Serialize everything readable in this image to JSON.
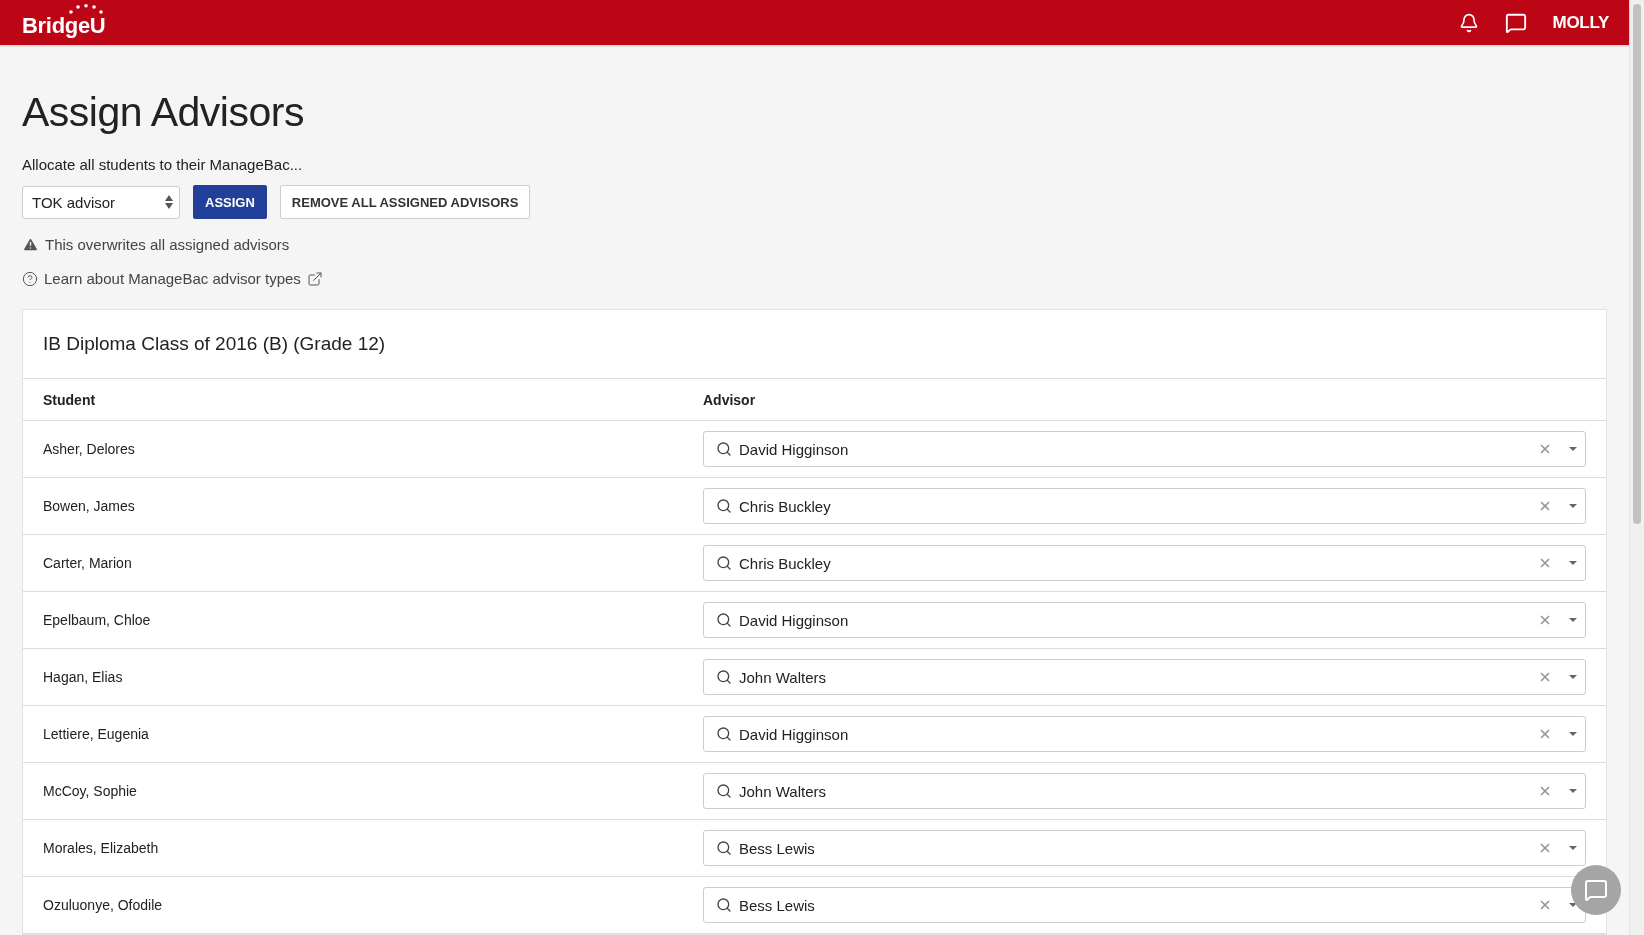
{
  "header": {
    "logo": "BridgeU",
    "user": "MOLLY"
  },
  "page": {
    "title": "Assign Advisors",
    "intro": "Allocate all students to their ManageBac...",
    "advisor_type": "TOK advisor",
    "assign_button": "ASSIGN",
    "remove_button": "REMOVE ALL ASSIGNED ADVISORS",
    "warning": "This overwrites all assigned advisors",
    "help_link": "Learn about ManageBac advisor types"
  },
  "table": {
    "title": "IB Diploma Class of 2016 (B) (Grade 12)",
    "columns": [
      "Student",
      "Advisor"
    ],
    "rows": [
      {
        "student": "Asher, Delores",
        "advisor": "David Higginson"
      },
      {
        "student": "Bowen, James",
        "advisor": "Chris Buckley"
      },
      {
        "student": "Carter, Marion",
        "advisor": "Chris Buckley"
      },
      {
        "student": "Epelbaum, Chloe",
        "advisor": "David Higginson"
      },
      {
        "student": "Hagan, Elias",
        "advisor": "John Walters"
      },
      {
        "student": "Lettiere, Eugenia",
        "advisor": "David Higginson"
      },
      {
        "student": "McCoy, Sophie",
        "advisor": "John Walters"
      },
      {
        "student": "Morales, Elizabeth",
        "advisor": "Bess Lewis"
      },
      {
        "student": "Ozuluonye, Ofodile",
        "advisor": "Bess Lewis"
      }
    ]
  }
}
